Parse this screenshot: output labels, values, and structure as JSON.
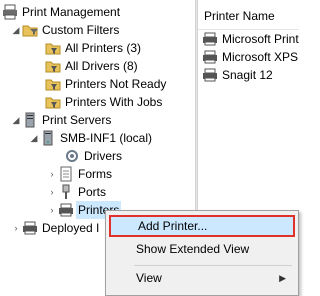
{
  "tree": {
    "root": {
      "label": "Print Management",
      "icon": "print-management-icon"
    },
    "custom_filters": {
      "label": "Custom Filters",
      "icon": "folder-filter-icon"
    },
    "filters": [
      {
        "label": "All Printers (3)",
        "icon": "filter-folder-icon"
      },
      {
        "label": "All Drivers (8)",
        "icon": "filter-folder-icon"
      },
      {
        "label": "Printers Not Ready",
        "icon": "filter-folder-icon"
      },
      {
        "label": "Printers With Jobs",
        "icon": "filter-folder-icon"
      }
    ],
    "print_servers": {
      "label": "Print Servers",
      "icon": "print-servers-icon"
    },
    "server": {
      "label": "SMB-INF1 (local)",
      "icon": "server-icon"
    },
    "server_children": [
      {
        "label": "Drivers",
        "icon": "drivers-icon"
      },
      {
        "label": "Forms",
        "icon": "forms-icon"
      },
      {
        "label": "Ports",
        "icon": "ports-icon"
      },
      {
        "label": "Printers",
        "icon": "printer-icon"
      }
    ],
    "deployed": {
      "label": "Deployed I",
      "icon": "deployed-printers-icon"
    }
  },
  "list": {
    "column_header": "Printer Name",
    "rows": [
      {
        "name": "Microsoft Print",
        "icon": "printer-icon"
      },
      {
        "name": "Microsoft XPS I",
        "icon": "printer-icon"
      },
      {
        "name": "Snagit 12",
        "icon": "printer-icon"
      }
    ]
  },
  "context_menu": {
    "items": [
      {
        "label": "Add Printer...",
        "highlighted": true
      },
      {
        "label": "Show Extended View"
      },
      {
        "label": "View",
        "submenu": true
      }
    ]
  },
  "colors": {
    "selection": "#cce8ff",
    "highlight_border": "#e0312b",
    "menu_bg": "#f0f0f0"
  }
}
